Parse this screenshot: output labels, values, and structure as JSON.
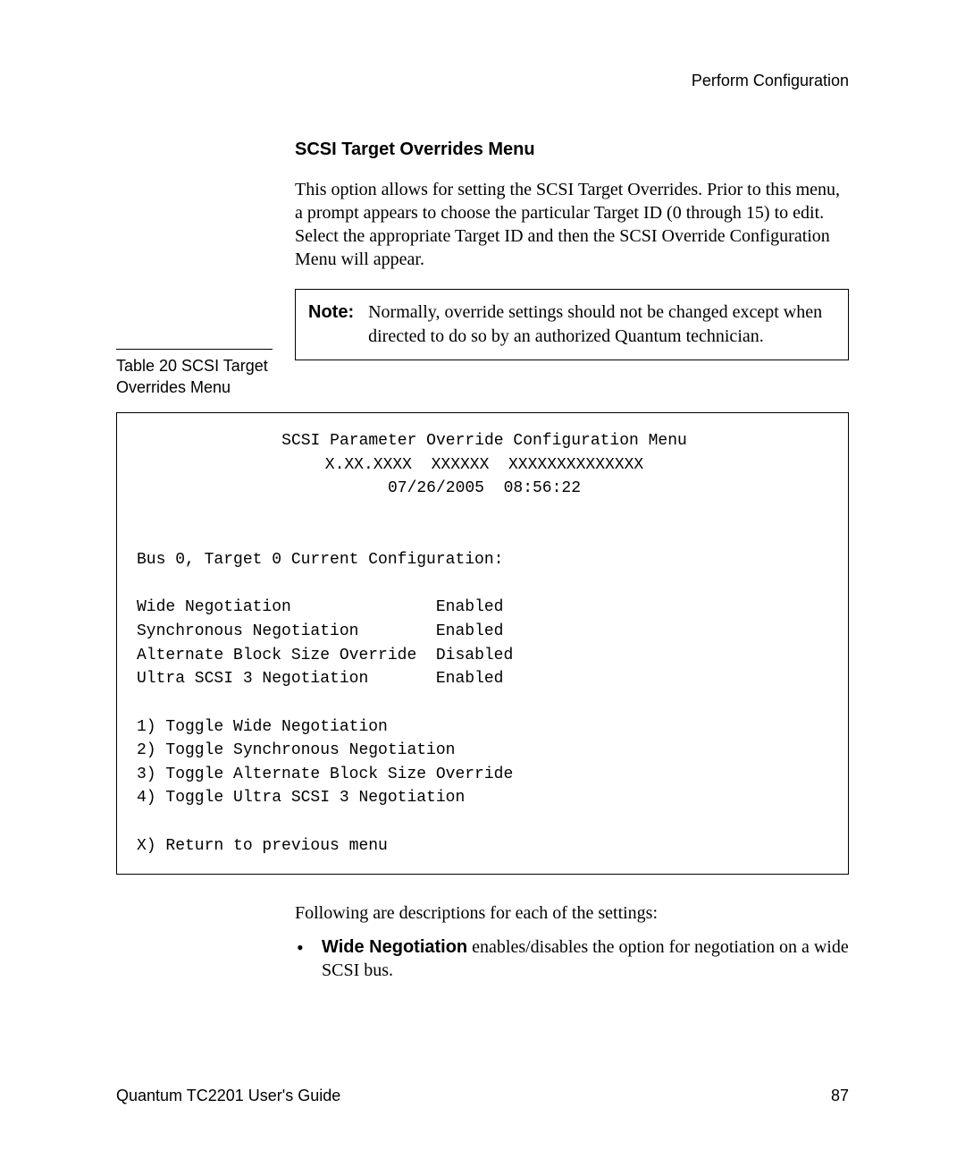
{
  "header": {
    "running_title": "Perform Configuration"
  },
  "section": {
    "heading": "SCSI Target Overrides Menu",
    "paragraph": "This option allows for setting the SCSI Target Overrides. Prior to this menu, a prompt appears to choose the particular Target ID (0 through 15) to edit. Select the appropriate Target ID and then the SCSI Override Configuration Menu will appear."
  },
  "note": {
    "label": "Note:",
    "text": "Normally, override settings should not be changed except when directed to do so by an authorized Quantum technician."
  },
  "table_caption": "Table 20  SCSI Target Overrides Menu",
  "terminal": {
    "title": "SCSI Parameter Override Configuration Menu",
    "version_line": "X.XX.XXXX  XXXXXX  XXXXXXXXXXXXXX",
    "timestamp": "07/26/2005  08:56:22",
    "context": "Bus 0, Target 0 Current Configuration:",
    "settings": [
      {
        "name": "Wide Negotiation",
        "value": "Enabled"
      },
      {
        "name": "Synchronous Negotiation",
        "value": "Enabled"
      },
      {
        "name": "Alternate Block Size Override",
        "value": "Disabled"
      },
      {
        "name": "Ultra SCSI 3 Negotiation",
        "value": "Enabled"
      }
    ],
    "options": [
      "1) Toggle Wide Negotiation",
      "2) Toggle Synchronous Negotiation",
      "3) Toggle Alternate Block Size Override",
      "4) Toggle Ultra SCSI 3 Negotiation"
    ],
    "exit": "X) Return to previous menu"
  },
  "post_text": "Following are descriptions for each of the settings:",
  "bullets": [
    {
      "bold": "Wide Negotiation",
      "rest": " enables/disables the option for negotiation on a wide SCSI bus."
    }
  ],
  "footer": {
    "doc_title": "Quantum TC2201 User's Guide",
    "page_number": "87"
  }
}
